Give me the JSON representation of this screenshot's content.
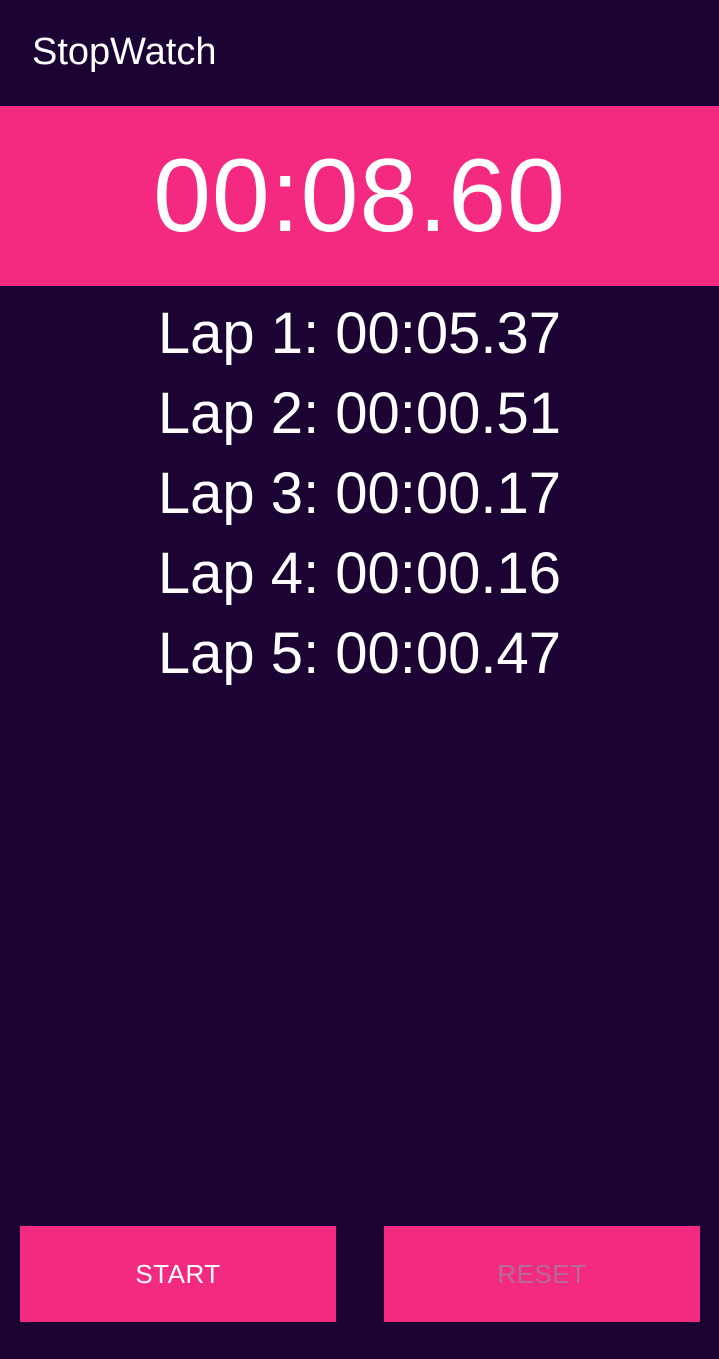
{
  "app_bar": {
    "title": "StopWatch"
  },
  "timer": {
    "display": "00:08.60"
  },
  "laps": [
    "Lap 1: 00:05.37",
    "Lap 2: 00:00.51",
    "Lap 3: 00:00.17",
    "Lap 4: 00:00.16",
    "Lap 5: 00:00.47"
  ],
  "buttons": {
    "start_label": "START",
    "reset_label": "RESET"
  },
  "colors": {
    "background": "#1b0333",
    "accent": "#f42a81",
    "text": "#ffffff",
    "disabled_text": "#b86a90"
  }
}
